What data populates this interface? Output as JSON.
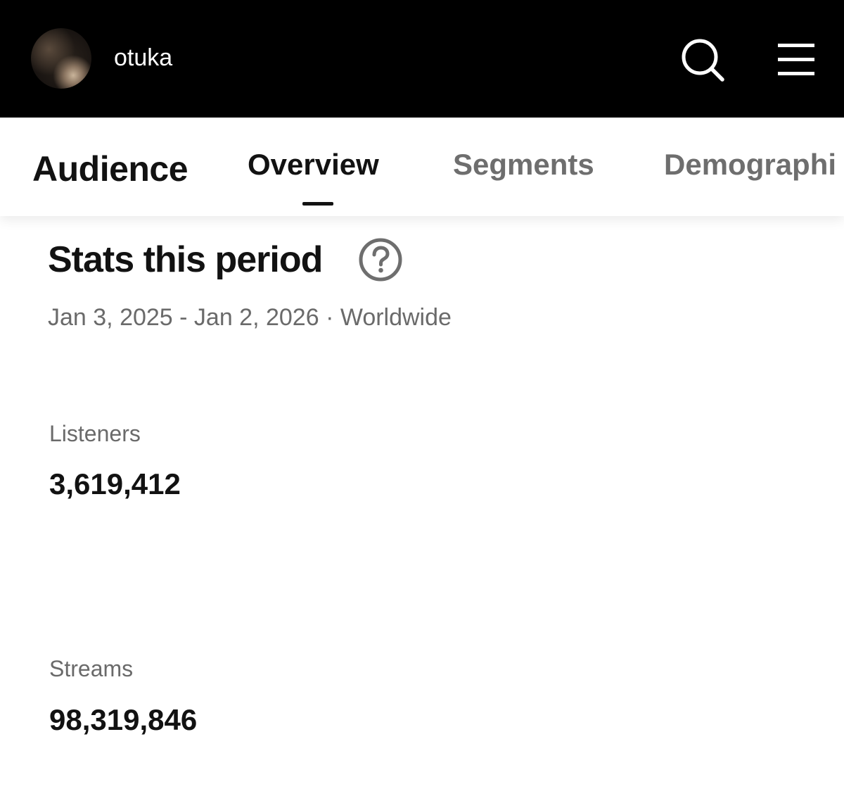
{
  "header": {
    "artist_name": "otuka",
    "icons": [
      "search-icon",
      "menu-icon"
    ]
  },
  "tabs": {
    "section_title": "Audience",
    "items": [
      {
        "label": "Overview",
        "active": true
      },
      {
        "label": "Segments",
        "active": false
      },
      {
        "label": "Demographi",
        "active": false
      }
    ]
  },
  "stats": {
    "heading": "Stats this period",
    "period": "Jan 3, 2025 - Jan 2, 2026 · Worldwide",
    "metrics": [
      {
        "label": "Listeners",
        "value": "3,619,412"
      },
      {
        "label": "Streams",
        "value": "98,319,846"
      }
    ]
  },
  "colors": {
    "header_bg": "#000000",
    "text_primary": "#121212",
    "text_secondary": "#6a6a6a"
  }
}
